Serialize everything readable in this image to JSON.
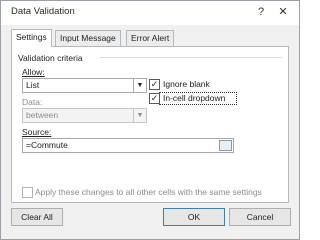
{
  "title": "Data Validation",
  "titlebar": {
    "help": "?",
    "close": "✕"
  },
  "tabs": [
    "Settings",
    "Input Message",
    "Error Alert"
  ],
  "settings": {
    "criteria_label": "Validation criteria",
    "allow_label": "Allow:",
    "allow_value": "List",
    "ignore_blank": "Ignore blank",
    "incell_dropdown": "In-cell dropdown",
    "data_label": "Data:",
    "data_value": "between",
    "source_label": "Source:",
    "source_value": "=Commute",
    "apply_all": "Apply these changes to all other cells with the same settings"
  },
  "buttons": {
    "clear_all": "Clear All",
    "ok": "OK",
    "cancel": "Cancel"
  }
}
